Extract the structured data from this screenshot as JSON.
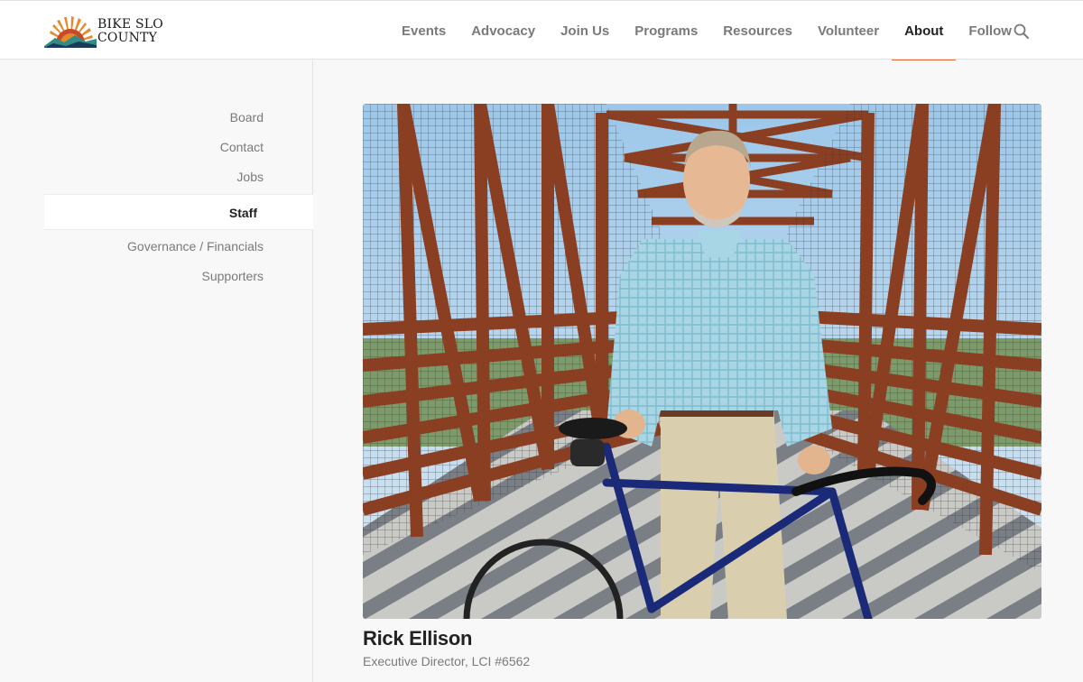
{
  "logo": {
    "line1": "BIKE SLO",
    "line2": "COUNTY",
    "colors": {
      "orange": "#e58a2c",
      "red": "#c94a2a",
      "teal": "#2f8d86",
      "navy": "#1d3a5c"
    }
  },
  "nav": {
    "items": [
      {
        "label": "Events"
      },
      {
        "label": "Advocacy"
      },
      {
        "label": "Join Us"
      },
      {
        "label": "Programs"
      },
      {
        "label": "Resources"
      },
      {
        "label": "Volunteer"
      },
      {
        "label": "About",
        "active": true
      },
      {
        "label": "Follow"
      }
    ],
    "search_icon": "search-icon",
    "accent": "#e06a3a"
  },
  "sidebar": {
    "items": [
      {
        "label": "Board"
      },
      {
        "label": "Contact"
      },
      {
        "label": "Jobs"
      },
      {
        "label": "Staff",
        "active": true
      },
      {
        "label": "Governance / Financials"
      },
      {
        "label": "Supporters"
      }
    ]
  },
  "staff": {
    "name": "Rick Ellison",
    "title": "Executive Director, LCI #6562"
  }
}
